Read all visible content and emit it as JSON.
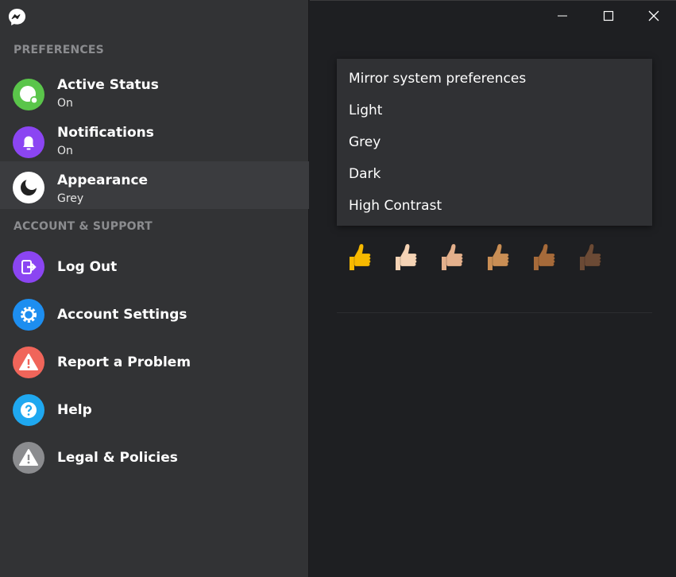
{
  "sidebar": {
    "sections": {
      "preferences": "PREFERENCES",
      "account": "ACCOUNT & SUPPORT"
    },
    "items": [
      {
        "title": "Active Status",
        "subtitle": "On",
        "icon": "active-status-icon",
        "color": "#5ac54a"
      },
      {
        "title": "Notifications",
        "subtitle": "On",
        "icon": "bell-icon",
        "color": "#8b45f2"
      },
      {
        "title": "Appearance",
        "subtitle": "Grey",
        "icon": "moon-icon",
        "color": "#ffffff"
      },
      {
        "title": "Log Out",
        "icon": "logout-icon",
        "color": "#8b45f2"
      },
      {
        "title": "Account Settings",
        "icon": "gear-icon",
        "color": "#1d8ef0"
      },
      {
        "title": "Report a Problem",
        "icon": "warning-icon",
        "color": "#f0655a"
      },
      {
        "title": "Help",
        "icon": "help-icon",
        "color": "#1fa8f0"
      },
      {
        "title": "Legal & Policies",
        "icon": "warning-icon",
        "color": "#8b8c8f"
      }
    ]
  },
  "appearance_menu": {
    "options": [
      "Mirror system preferences",
      "Light",
      "Grey",
      "Dark",
      "High Contrast"
    ]
  },
  "thumbs": {
    "colors": [
      "#f7b900",
      "#f5d3b5",
      "#e4b08c",
      "#c98e55",
      "#a66a3a",
      "#6b4a35"
    ]
  }
}
